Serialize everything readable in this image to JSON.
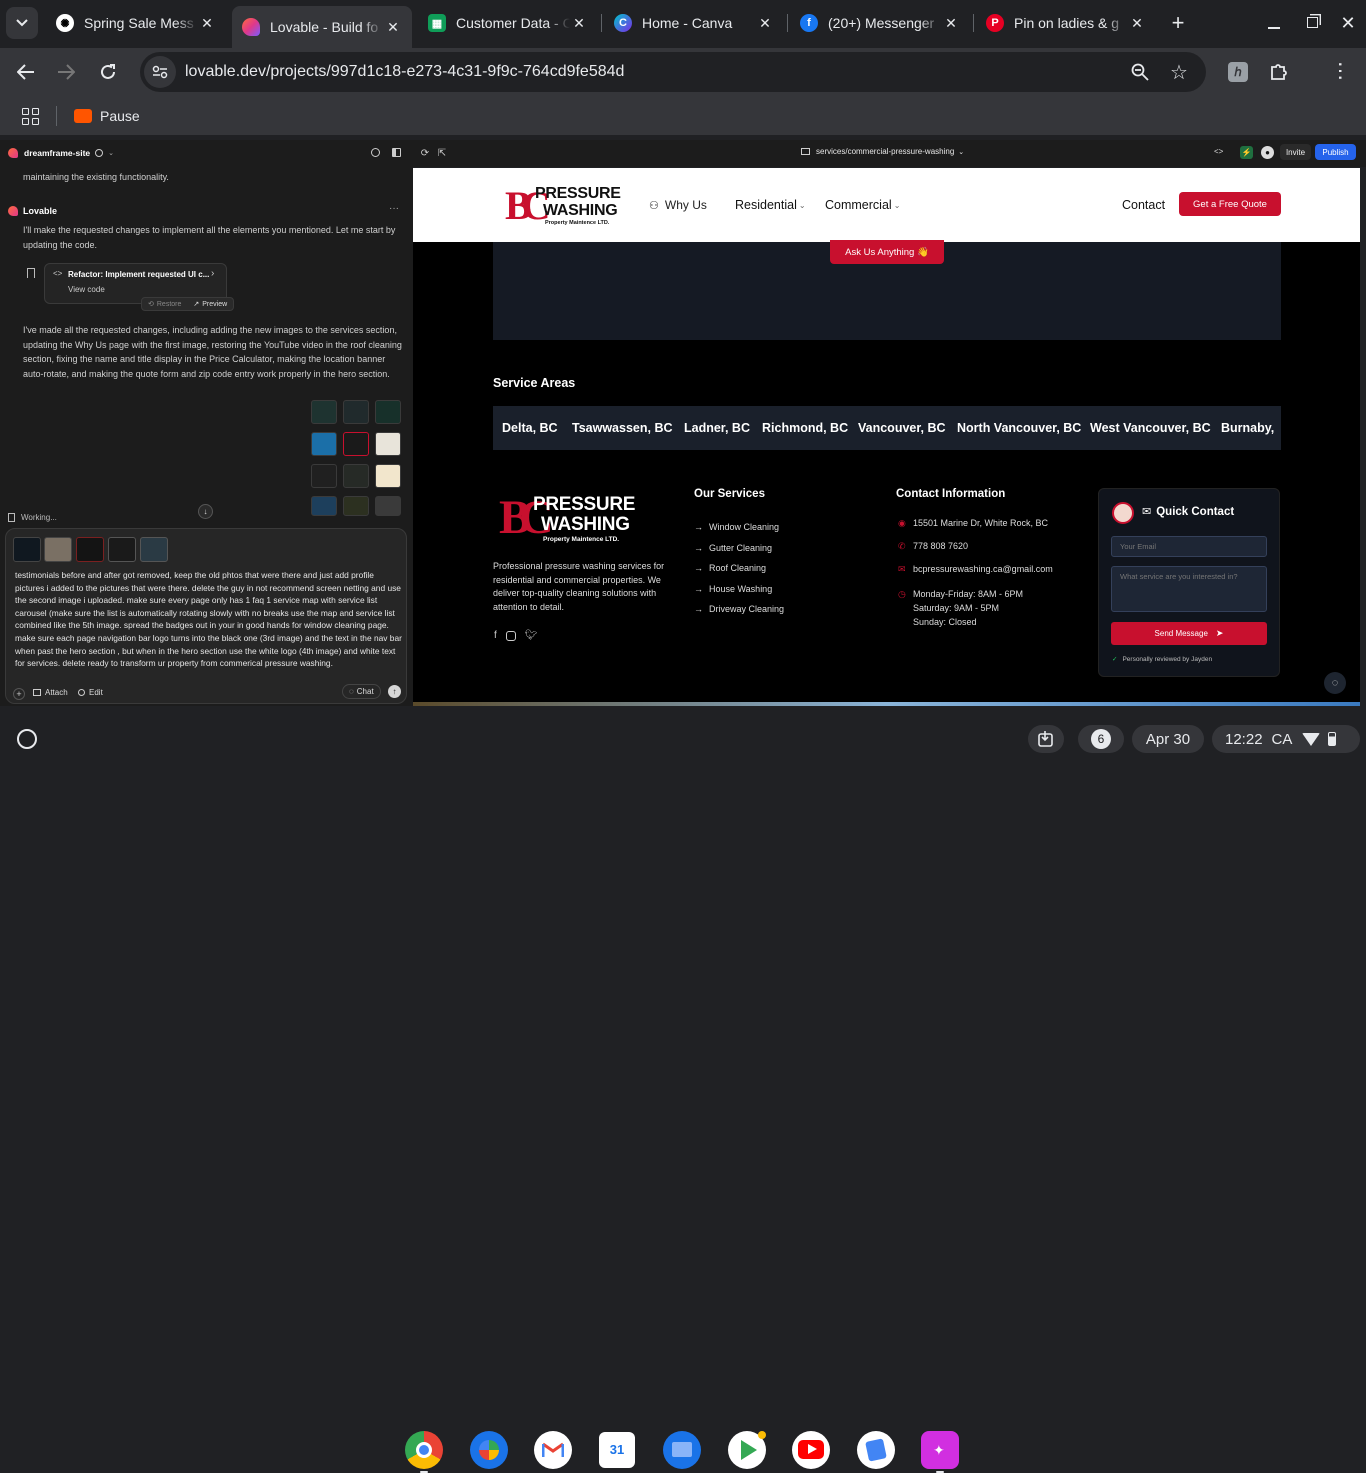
{
  "browser": {
    "tabs": [
      {
        "title": "Spring Sale Mess",
        "icon": "openai-icon",
        "active": false
      },
      {
        "title": "Lovable - Build fo",
        "icon": "lovable-icon",
        "active": true
      },
      {
        "title": "Customer Data - C",
        "icon": "google-sheets-icon",
        "active": false
      },
      {
        "title": "Home - Canva",
        "icon": "canva-icon",
        "active": false
      },
      {
        "title": "(20+) Messenger",
        "icon": "facebook-icon",
        "active": false
      },
      {
        "title": "Pin on ladies & g",
        "icon": "pinterest-icon",
        "active": false
      }
    ],
    "url": "lovable.dev/projects/997d1c18-e273-4c31-9f9c-764cd9fe584d",
    "bookmark": "Pause",
    "colors": {
      "frame": "#202124",
      "toolbar": "#35363a"
    }
  },
  "lovable": {
    "project_name": "dreamframe-site",
    "top_message_tail": "maintaining the existing functionality.",
    "assistant_name": "Lovable",
    "msg1": "I'll make the requested changes to implement all the elements you mentioned. Let me start by updating the code.",
    "commit_title": "Refactor: Implement requested UI c...",
    "commit_view_code": "View code",
    "restore_label": "Restore",
    "preview_label": "Preview",
    "msg2": "I've made all the requested changes, including adding the new images to the services section, updating the Why Us page with the first image, restoring the YouTube video in the roof cleaning section, fixing the name and title display in the Price Calculator, making the location banner auto-rotate, and making the quote form and zip code entry work properly in the hero section.",
    "working_label": "Working...",
    "prompt_text": "testimonials before and after got removed, keep the old phtos that were there and just add profile pictures i added to the pictures that were there. delete the guy in not recommend screen netting and use the second image i uploaded. make sure every page only has 1 faq 1 service map with service list carousel (make sure the list is automatically rotating slowly with no breaks use the map and service list combined like the 5th image. spread the badges out in your in good hands for window cleaning page. make sure each page navigation bar logo turns into the black one (3rd image) and the text in the nav bar when past the hero section , but when in the hero section use the white logo (4th image) and white text for services. delete ready to transform ur property from commerical pressure washing.",
    "attach_label": "Attach",
    "edit_label": "Edit",
    "chat_label": "Chat",
    "route": "services/commercial-pressure-washing",
    "invite_label": "Invite",
    "publish_label": "Publish",
    "publish_color": "#2563eb"
  },
  "site": {
    "logo_line1": "PRESSURE",
    "logo_line2": "WASHING",
    "logo_sub": "Property Maintence LTD.",
    "nav": {
      "why_us": "Why Us",
      "residential": "Residential",
      "commercial": "Commercial",
      "contact": "Contact",
      "cta": "Get a Free Quote"
    },
    "ask_button": "Ask Us Anything 👋",
    "service_areas_title": "Service Areas",
    "service_areas": [
      "Delta, BC",
      "Tsawwassen, BC",
      "Ladner, BC",
      "Richmond, BC",
      "Vancouver, BC",
      "North Vancouver, BC",
      "West Vancouver, BC",
      "Burnaby,"
    ],
    "footer": {
      "description": "Professional pressure washing services for residential and commercial properties. We deliver top-quality cleaning solutions with attention to detail.",
      "services_title": "Our Services",
      "services": [
        "Window Cleaning",
        "Gutter Cleaning",
        "Roof Cleaning",
        "House Washing",
        "Driveway Cleaning"
      ],
      "contact_title": "Contact Information",
      "address": "15501 Marine Dr, White Rock, BC",
      "phone": "778 808 7620",
      "email": "bcpressurewashing.ca@gmail.com",
      "hours": [
        "Monday-Friday: 8AM - 6PM",
        "Saturday: 9AM - 5PM",
        "Sunday: Closed"
      ],
      "quick_contact_title": "Quick Contact",
      "email_placeholder": "Your Email",
      "service_placeholder": "What service are you interested in?",
      "send_label": "Send Message",
      "reviewed_note": "Personally reviewed by Jayden"
    },
    "brand_red": "#c8102e"
  },
  "shelf": {
    "notification_count": "6",
    "date": "Apr 30",
    "time": "12:22",
    "region": "CA"
  }
}
